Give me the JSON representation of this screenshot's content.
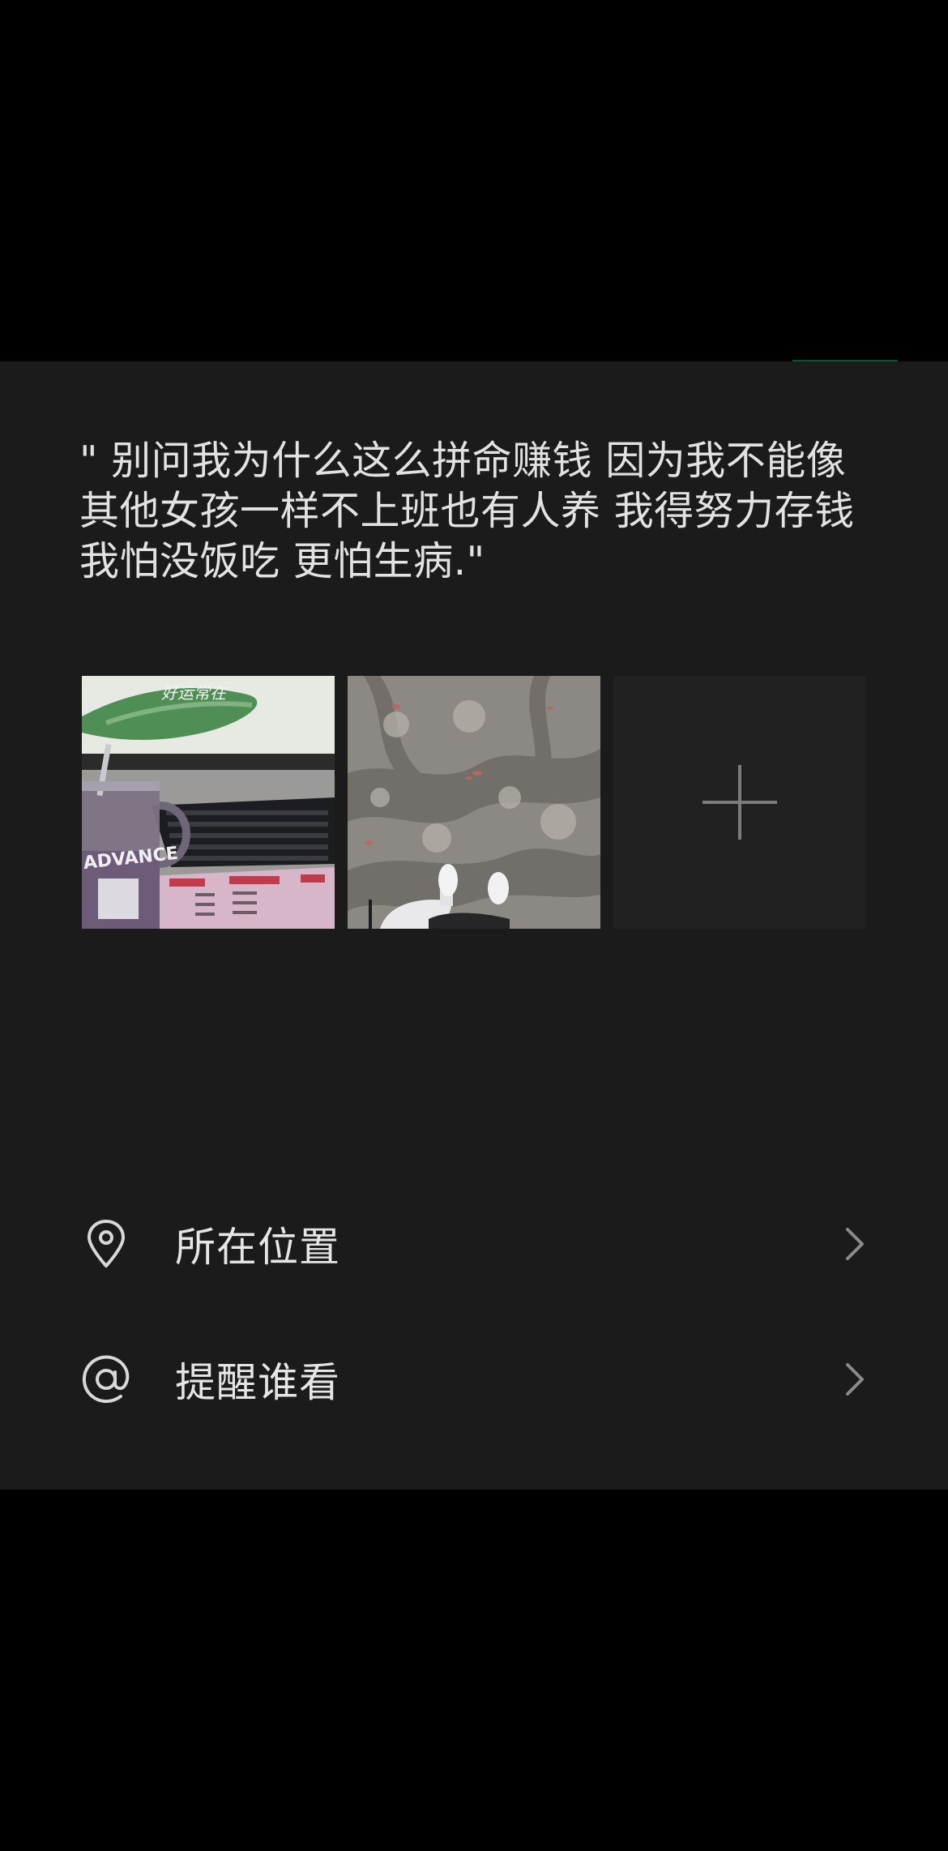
{
  "post": {
    "text": "\" 别问我为什么这么拼命赚钱 因为我不能像其他女孩一样不上班也有人养 我得努力存钱 我怕没饭吃 更怕生病.\""
  },
  "photos": [
    {
      "name": "desk-keyboard-photo",
      "overlay_text": "好运常在",
      "mug_text": "ADVANCE"
    },
    {
      "name": "shadow-street-photo"
    }
  ],
  "add_photo": {
    "icon": "plus-icon"
  },
  "rows": [
    {
      "label": "所在位置",
      "icon": "location-pin-icon"
    },
    {
      "label": "提醒谁看",
      "icon": "at-sign-icon"
    }
  ],
  "colors": {
    "panel_bg": "#1b1b1b",
    "text": "#e2e2e2",
    "accent": "#07c160",
    "tile_bg": "#212121",
    "icon": "#d8d8d8",
    "chevron": "#8a8a8a"
  }
}
